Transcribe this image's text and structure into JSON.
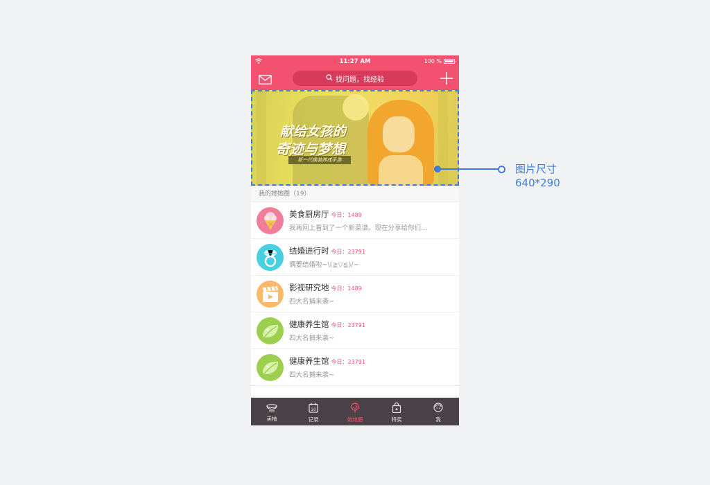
{
  "status_bar": {
    "time": "11:27 AM",
    "battery": "100 %",
    "wifi_icon": "wifi-icon"
  },
  "nav": {
    "search_placeholder": "找问题，找经验",
    "left_icon": "mail-icon",
    "right_icon": "plus-icon"
  },
  "banner": {
    "title_line1": "献给女孩的",
    "title_line2": "奇迹与梦想",
    "tagline": "新一代换装养成手游"
  },
  "section": {
    "title": "我的她她圈（19）"
  },
  "list": [
    {
      "title": "美食厨房厅",
      "today": "今日：1489",
      "subtitle": "我再网上看到了一个新菜谱，现在分享给你们…",
      "icon": "ice-cream-icon",
      "color": "#f07e9a"
    },
    {
      "title": "结婚进行时",
      "today": "今日：23791",
      "subtitle": "偶要结婚啦~\\(≧▽≦)/~",
      "icon": "ring-icon",
      "color": "#48d0e0"
    },
    {
      "title": "影视研究地",
      "today": "今日：1489",
      "subtitle": "四大名捕来袭~",
      "icon": "clapperboard-icon",
      "color": "#f9b96a"
    },
    {
      "title": "健康养生馆",
      "today": "今日：23791",
      "subtitle": "四大名捕来袭~",
      "icon": "leaf-icon",
      "color": "#9ccf4f"
    },
    {
      "title": "健康养生馆",
      "today": "今日：23791",
      "subtitle": "四大名捕来袭~",
      "icon": "leaf-icon",
      "color": "#9ccf4f"
    }
  ],
  "tabs": [
    {
      "label": "美柚",
      "icon": "bowl-icon",
      "active": false
    },
    {
      "label": "记录",
      "icon": "calendar-icon",
      "active": false
    },
    {
      "label": "她她圈",
      "icon": "lollipop-icon",
      "active": true
    },
    {
      "label": "特卖",
      "icon": "shopping-bag-icon",
      "active": false
    },
    {
      "label": "我",
      "icon": "profile-icon",
      "active": false
    }
  ],
  "annotation": {
    "line1": "图片尺寸",
    "line2": "640*290"
  },
  "colors": {
    "brand": "#f2516f",
    "annotation": "#3f7bd6",
    "tabbar": "#4a4246"
  }
}
